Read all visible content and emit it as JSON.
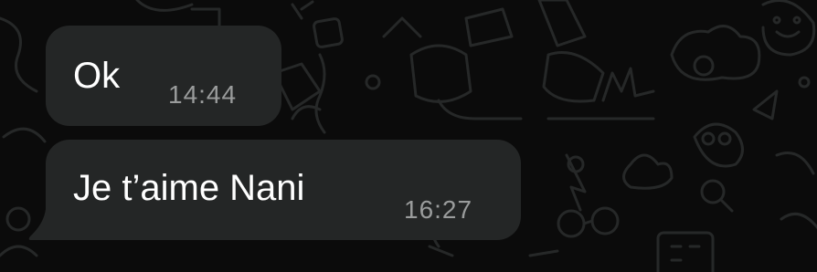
{
  "colors": {
    "background": "#0b0b0b",
    "bubble": "#242626",
    "message_text": "#ffffff",
    "timestamp": "#9a9c9c",
    "wallpaper_line": "#262828"
  },
  "messages": [
    {
      "text": "Ok",
      "time": "14:44"
    },
    {
      "text": "Je t’aime Nani",
      "time": "16:27"
    }
  ],
  "wallpaper": {
    "icon": "doodle-pattern"
  }
}
